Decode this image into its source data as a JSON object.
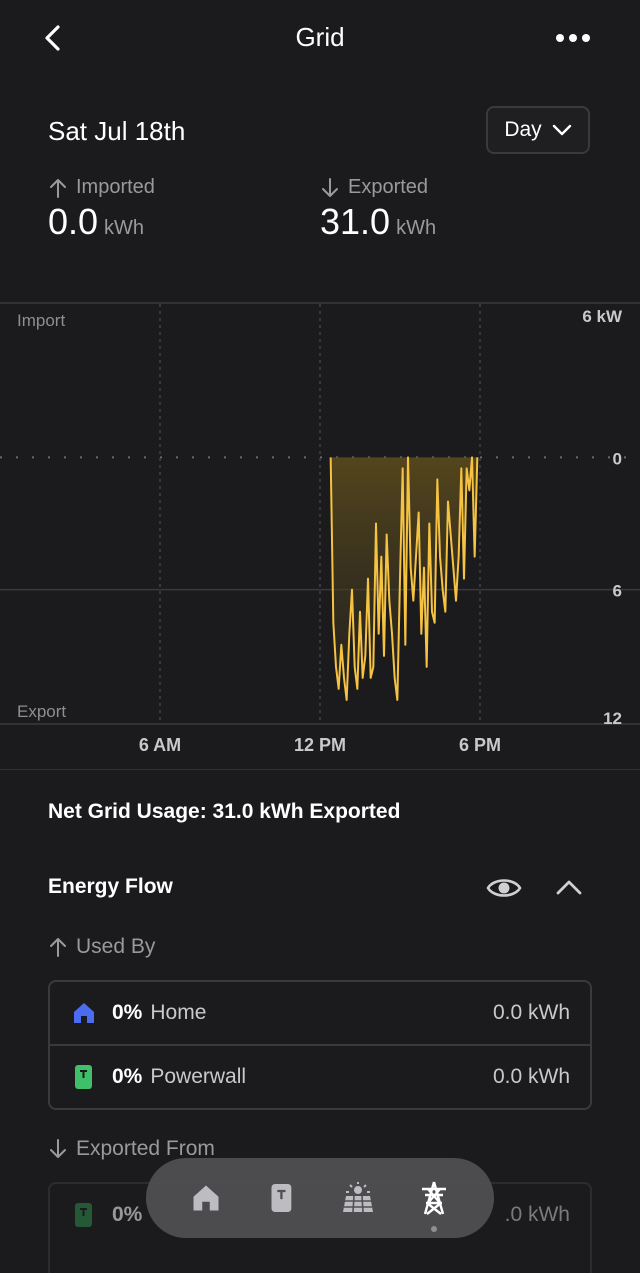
{
  "header": {
    "title": "Grid"
  },
  "date": {
    "title": "Sat Jul 18th",
    "range": "Day"
  },
  "stats": {
    "imported": {
      "label": "Imported",
      "value": "0.0",
      "unit": "kWh"
    },
    "exported": {
      "label": "Exported",
      "value": "31.0",
      "unit": "kWh"
    }
  },
  "chart_data": {
    "type": "area",
    "title": "",
    "top_label": "Import",
    "bottom_label": "Export",
    "unit": "kW",
    "y_ticks": [
      {
        "label": "6 kW",
        "value": -6
      },
      {
        "label": "0",
        "value": 0
      },
      {
        "label": "6",
        "value": 6
      },
      {
        "label": "12",
        "value": 12
      }
    ],
    "ylim": [
      -6,
      12
    ],
    "x_ticks": [
      {
        "label": "6 AM",
        "hour": 6
      },
      {
        "label": "12 PM",
        "hour": 12
      },
      {
        "label": "6 PM",
        "hour": 18
      }
    ],
    "xlim": [
      0,
      24
    ],
    "series": [
      {
        "values_hour": [
          12.4,
          12.5,
          12.6,
          12.7,
          12.8,
          12.9,
          13.0,
          13.1,
          13.2,
          13.3,
          13.4,
          13.5,
          13.6,
          13.7,
          13.8,
          13.9,
          14.0,
          14.1,
          14.2,
          14.3,
          14.4,
          14.5,
          14.6,
          14.7,
          14.8,
          14.9,
          15.0,
          15.1,
          15.2,
          15.3,
          15.4,
          15.5,
          15.6,
          15.7,
          15.8,
          15.9,
          16.0,
          16.1,
          16.2,
          16.3,
          16.4,
          16.5,
          16.6,
          16.7,
          16.8,
          16.9,
          17.0,
          17.1,
          17.2,
          17.3,
          17.4,
          17.5,
          17.6,
          17.7,
          17.8,
          17.9
        ],
        "values_kw": [
          0.0,
          7.5,
          9.5,
          10.5,
          8.5,
          10.0,
          11.0,
          8.0,
          6.0,
          9.5,
          10.5,
          7.0,
          10.0,
          9.0,
          5.5,
          10.0,
          9.5,
          3.0,
          8.0,
          4.5,
          9.0,
          3.5,
          6.5,
          8.0,
          10.0,
          11.0,
          5.5,
          0.5,
          8.5,
          0.0,
          5.0,
          6.5,
          4.5,
          2.5,
          8.0,
          5.0,
          9.5,
          3.0,
          7.0,
          7.5,
          1.0,
          4.5,
          6.0,
          7.0,
          2.0,
          3.5,
          5.0,
          6.5,
          4.5,
          0.5,
          5.5,
          0.5,
          1.5,
          0.0,
          4.5,
          0.0
        ]
      }
    ],
    "colors": {
      "series": "#f5c242",
      "fill": "#3a3320"
    }
  },
  "net_usage": "Net Grid Usage: 31.0 kWh Exported",
  "energy_flow": {
    "title": "Energy Flow",
    "used_by_label": "Used By",
    "used_by": [
      {
        "pct": "0%",
        "name": "Home",
        "kwh": "0.0 kWh",
        "icon": "home-icon"
      },
      {
        "pct": "0%",
        "name": "Powerwall",
        "kwh": "0.0 kWh",
        "icon": "powerwall-icon"
      }
    ],
    "exported_from_label": "Exported From",
    "exported_from": [
      {
        "pct": "0%",
        "name": "",
        "kwh": ".0 kWh",
        "icon": "powerwall-icon"
      }
    ]
  },
  "tabbar": {
    "tabs": [
      "home-tab",
      "powerwall-tab",
      "solar-tab",
      "grid-tab"
    ],
    "active": "grid-tab"
  }
}
